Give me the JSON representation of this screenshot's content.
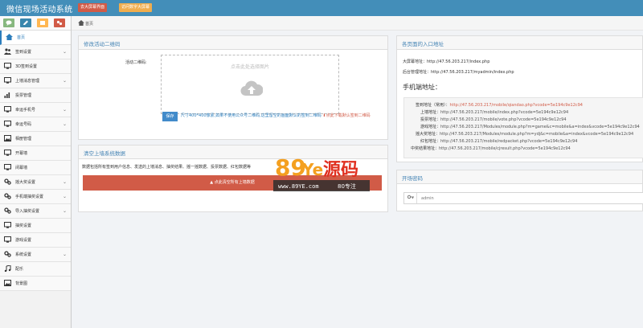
{
  "header": {
    "brand": "微信现场活动系统",
    "btn_big_screen": "去大屏幕界面",
    "btn_second": "访问数字大屏幕"
  },
  "sidebar": {
    "items": [
      {
        "label": "首页",
        "icon": "home-icon",
        "chevron": false,
        "active": true
      },
      {
        "label": "签到设置",
        "icon": "users-icon",
        "chevron": true
      },
      {
        "label": "3D签到设置",
        "icon": "desktop-icon",
        "chevron": false
      },
      {
        "label": "上墙消息管理",
        "icon": "desktop-icon",
        "chevron": true
      },
      {
        "label": "投票管理",
        "icon": "bar-chart-icon",
        "chevron": false
      },
      {
        "label": "幸运手机号",
        "icon": "desktop-icon",
        "chevron": true
      },
      {
        "label": "幸运号码",
        "icon": "desktop-icon",
        "chevron": true
      },
      {
        "label": "相册管理",
        "icon": "picture-icon",
        "chevron": false
      },
      {
        "label": "开幕墙",
        "icon": "desktop-icon",
        "chevron": false
      },
      {
        "label": "闭幕墙",
        "icon": "desktop-icon",
        "chevron": false
      },
      {
        "label": "摇大奖设置",
        "icon": "cogs-icon",
        "chevron": true
      },
      {
        "label": "手机端抽奖设置",
        "icon": "cogs-icon",
        "chevron": true
      },
      {
        "label": "导入抽奖设置",
        "icon": "cogs-icon",
        "chevron": true
      },
      {
        "label": "抽奖设置",
        "icon": "desktop-icon",
        "chevron": false
      },
      {
        "label": "游戏设置",
        "icon": "desktop-icon",
        "chevron": false
      },
      {
        "label": "系统设置",
        "icon": "cogs-icon",
        "chevron": true
      },
      {
        "label": "配乐",
        "icon": "music-icon",
        "chevron": false
      },
      {
        "label": "背景图",
        "icon": "picture-icon",
        "chevron": false
      }
    ]
  },
  "breadcrumb": {
    "label": "首页"
  },
  "qr_panel": {
    "title": "修改活动二维码",
    "field_label": "活动二维码:",
    "upload_text": "点击此处选择图片",
    "save_label": "保存",
    "hint": "尺寸400*400像素,如果不使用公众号二维码,这里留空的画面默认的签到二维码",
    "download": "点此下载默认签到二维码"
  },
  "clear_panel": {
    "title": "清空上墙系统数据",
    "desc": "数据包括所有签到用户信息、发送的上墙消息、抽奖结果、摇一摇数据、投票数据、红包数据等",
    "button": "点此清空所有上墙数据"
  },
  "entry_panel": {
    "title": "各页面的入口地址",
    "big_screen": "大屏幕地址：http://47.56.203.217/index.php",
    "admin": "后台管理地址：http://47.56.203.217/myadmin/index.php",
    "mobile_title": "手机端地址：",
    "mobile_lines": [
      {
        "label": "签到地址（常用）：",
        "url": "http://47.56.203.217/mobile/qiandao.php?vcode=5e194c9e12c94"
      },
      {
        "label": "上墙地址：",
        "url": "http://47.56.203.217/mobile/index.php?vcode=5e194c9e12c94"
      },
      {
        "label": "投票地址：",
        "url": "http://47.56.203.217/mobile/vote.php?vcode=5e194c9e12c94"
      },
      {
        "label": "游戏地址：",
        "url": "http://47.56.203.217/Modules/module.php?m=game&c=mobile&a=index&vcode=5e194c9e12c94"
      },
      {
        "label": "摇大奖地址：",
        "url": "http://47.56.203.217/Modules/module.php?m=ydj&c=mobile&a=index&vcode=5e194c9e12c94"
      },
      {
        "label": "红包地址：",
        "url": "http://47.56.203.217/mobile/redpacket.php?vcode=5e194c9e12c94"
      },
      {
        "label": "中奖结果地址：",
        "url": "http://47.56.203.217/mobile/cjresult.php?vcode=5e194c9e12c94"
      }
    ]
  },
  "password_panel": {
    "title": "开场密码",
    "value": "admin"
  },
  "watermark": {
    "brand_89": "89",
    "brand_ye": "Ye",
    "brand_cn": "源码",
    "url": "www.89YE.com",
    "tag": "80专注"
  }
}
